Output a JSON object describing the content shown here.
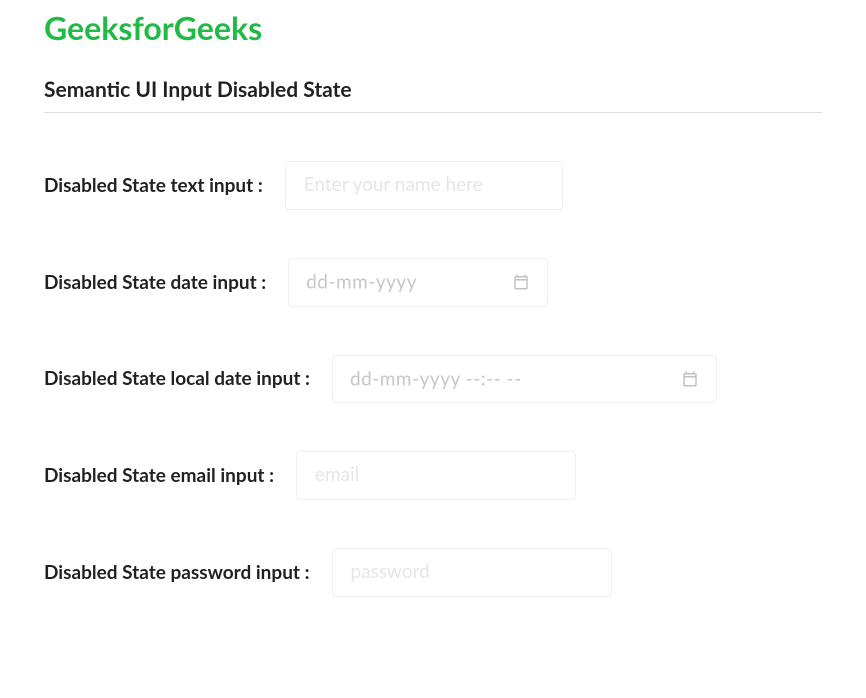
{
  "header": {
    "site_title": "GeeksforGeeks",
    "subtitle": "Semantic UI Input Disabled State"
  },
  "fields": {
    "text": {
      "label": "Disabled State text input :",
      "placeholder": "Enter your name here",
      "value": ""
    },
    "date": {
      "label": "Disabled State date input :",
      "placeholder": "dd-mm-yyyy",
      "value": ""
    },
    "localdate": {
      "label": "Disabled State local date input :",
      "placeholder": "dd-mm-yyyy --:-- --",
      "value": ""
    },
    "email": {
      "label": "Disabled State email input :",
      "placeholder": "email",
      "value": ""
    },
    "password": {
      "label": "Disabled State password input :",
      "placeholder": "password",
      "value": ""
    }
  },
  "colors": {
    "brand_green": "#21ba45",
    "border": "rgba(34,36,38,0.15)"
  }
}
